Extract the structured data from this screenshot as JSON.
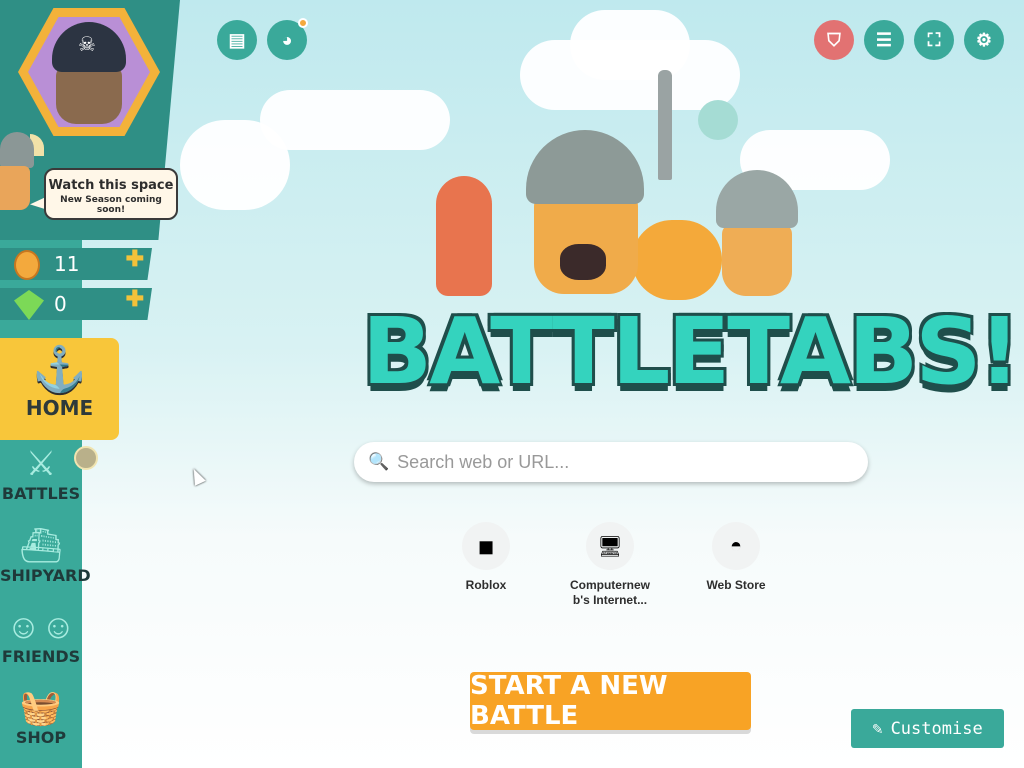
{
  "profile": {
    "bubble_line1": "Watch this space",
    "bubble_line2": "New Season coming soon!"
  },
  "currencies": [
    {
      "name": "coins",
      "icon": "coin-icon",
      "value": "11"
    },
    {
      "name": "gems",
      "icon": "gem-icon",
      "value": "0"
    }
  ],
  "nav": {
    "home": {
      "label": "HOME",
      "icon": "anchor-icon"
    },
    "items": [
      {
        "label": "BATTLES",
        "icon": "crossed-axes-icon"
      },
      {
        "label": "SHIPYARD",
        "icon": "ship-icon"
      },
      {
        "label": "FRIENDS",
        "icon": "friends-icon"
      },
      {
        "label": "SHOP",
        "icon": "basket-icon"
      }
    ]
  },
  "top_left_buttons": [
    {
      "icon": "news-icon"
    },
    {
      "icon": "discord-icon"
    }
  ],
  "top_right_buttons": [
    {
      "icon": "shield-icon"
    },
    {
      "icon": "list-icon"
    },
    {
      "icon": "fullscreen-icon"
    },
    {
      "icon": "gear-icon"
    }
  ],
  "logo": {
    "text": "BATTLETABS!"
  },
  "search": {
    "placeholder": "Search web or URL..."
  },
  "shortcuts": [
    {
      "name": "Roblox"
    },
    {
      "name": "Computernew b's Internet..."
    },
    {
      "name": "Web Store"
    }
  ],
  "start_button": {
    "label": "START A NEW BATTLE"
  },
  "customise_button": {
    "label": "Customise"
  },
  "colors": {
    "teal": "#3aa99a",
    "yellow": "#f8c63a",
    "orange": "#f8a325",
    "logo": "#34d3be"
  }
}
